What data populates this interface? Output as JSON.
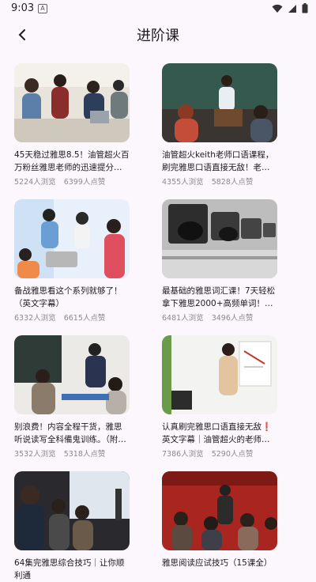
{
  "status": {
    "time": "9:03",
    "notif_badge": "A"
  },
  "header": {
    "title": "进阶课"
  },
  "courses": [
    {
      "title": "45天稳过雅思8.5！油管超火百万粉丝雅思老师的迅速提分课程！不看...",
      "views": "5224人浏览",
      "likes": "6399人点赞"
    },
    {
      "title": "油管超火keith老师口语课程，刷完雅思口语直接无敌！老师真的超级有趣",
      "views": "4355人浏览",
      "likes": "5828人点赞"
    },
    {
      "title": "备战雅思看这个系列就够了！（英文字幕）",
      "views": "6332人浏览",
      "likes": "6615人点赞"
    },
    {
      "title": "最基础的雅思词汇课！7天轻松拿下雅思2000+高频单词！一节课一个测试...",
      "views": "6481人浏览",
      "likes": "3496人点赞"
    },
    {
      "title": "别浪费！内容全程干货，雅思听说读写全科備鬼训练。（附配套资料）",
      "views": "3532人浏览",
      "likes": "5318人点赞"
    },
    {
      "title": "认真刷完雅思口语直接无敌❗英文字幕｜油管超火的老师｜Vocabulary f...",
      "views": "7386人浏览",
      "likes": "5290人点赞"
    },
    {
      "title": "64集完雅思综合技巧｜让你顺利通",
      "views": "",
      "likes": ""
    },
    {
      "title": "雅思阅读应试技巧（15课全）",
      "views": "",
      "likes": ""
    }
  ]
}
